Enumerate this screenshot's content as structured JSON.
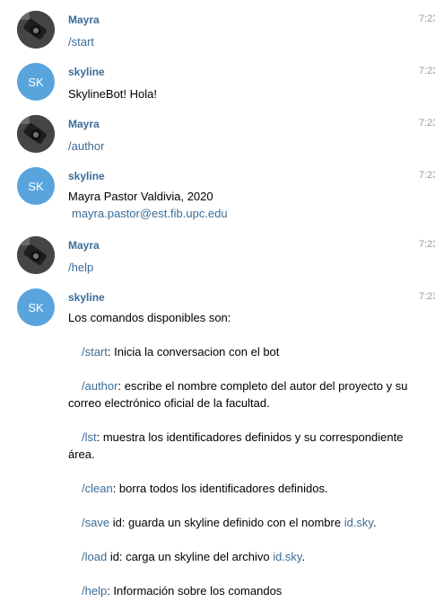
{
  "messages": [
    {
      "sender": "Mayra",
      "time": "7:23",
      "text": "/start"
    },
    {
      "sender": "skyline",
      "avatar": "SK",
      "time": "7:23",
      "text": "SkylineBot! Hola!"
    },
    {
      "sender": "Mayra",
      "time": "7:23",
      "text": "/author"
    },
    {
      "sender": "skyline",
      "avatar": "SK",
      "time": "7:23",
      "line1": "Mayra Pastor Valdivia, 2020",
      "email": "mayra.pastor@est.fib.upc.edu"
    },
    {
      "sender": "Mayra",
      "time": "7:23",
      "text": "/help"
    },
    {
      "sender": "skyline",
      "avatar": "SK",
      "time": "7:23",
      "intro": "Los comandos disponibles son:",
      "commands": [
        {
          "cmd": "/start",
          "desc": ": Inicia la conversacion con el bot"
        },
        {
          "cmd": "/author",
          "desc": ": escribe el nombre completo del autor del proyecto y su correo electrónico oficial de la facultad."
        },
        {
          "cmd": "/lst",
          "desc": ": muestra los identificadores definidos y su correspondiente área."
        },
        {
          "cmd": "/clean",
          "desc": ": borra todos los identificadores definidos."
        },
        {
          "cmd": "/save",
          "desc": " id: guarda un skyline definido con el nombre ",
          "link": "id.sky",
          "after": "."
        },
        {
          "cmd": "/load",
          "desc": " id: carga un skyline del archivo ",
          "link": "id.sky",
          "after": "."
        },
        {
          "cmd": "/help",
          "desc": ": Información sobre los comandos"
        }
      ]
    }
  ],
  "colors": {
    "accent": "#3a6d99",
    "avatar_bg": "#5aa4dd",
    "time": "#999999"
  },
  "icons": {
    "user_avatar": "camera-photo-avatar"
  }
}
